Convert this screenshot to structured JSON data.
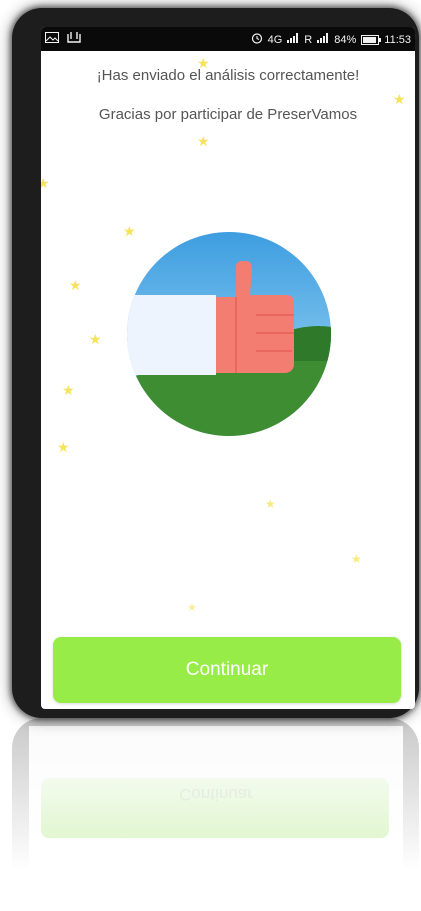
{
  "status_bar": {
    "left_icons": [
      "image-icon",
      "download-icon"
    ],
    "network_label": "4G",
    "roaming_label": "R",
    "battery_percent": "84%",
    "time": "11:53"
  },
  "message": {
    "title": "¡Has enviado el análisis correctamente!",
    "subtitle": "Gracias por participar de PreserVamos"
  },
  "illustration": {
    "icon": "thumbs-up-icon",
    "colors": {
      "sky": "#4da9e6",
      "hill": "#3f8d33",
      "sleeve": "#eef4fd",
      "hand": "#f47d72"
    }
  },
  "button": {
    "label": "Continuar",
    "color": "#98ec48"
  },
  "star_color": "#f5e35a"
}
